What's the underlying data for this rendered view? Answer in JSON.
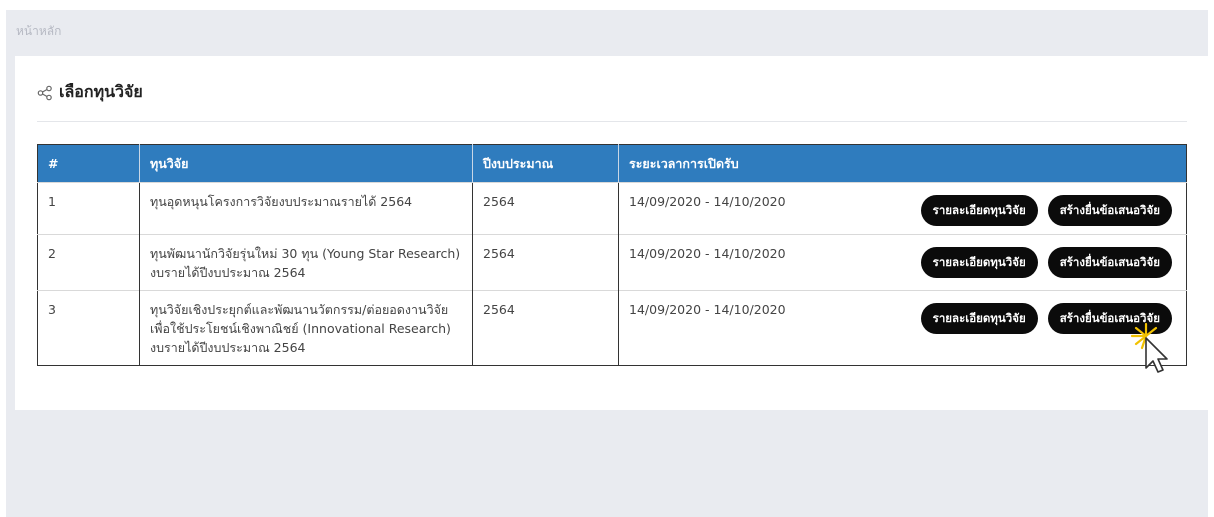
{
  "breadcrumb": "หน้าหลัก",
  "card": {
    "title": "เลือกทุนวิจัย",
    "title_icon": "share-icon"
  },
  "table": {
    "headers": [
      "#",
      "ทุนวิจัย",
      "ปีงบประมาณ",
      "ระยะเวลาการเปิดรับ"
    ],
    "rows": [
      {
        "num": "1",
        "fund": "ทุนอุดหนุนโครงการวิจัยงบประมาณรายได้ 2564",
        "year": "2564",
        "period": "14/09/2020 - 14/10/2020",
        "detail_label": "รายละเอียดทุนวิจัย",
        "create_label": "สร้างยื่นข้อเสนอวิจัย"
      },
      {
        "num": "2",
        "fund": "ทุนพัฒนานักวิจัยรุ่นใหม่ 30 ทุน (Young Star Research) งบรายได้ปีงบประมาณ 2564",
        "year": "2564",
        "period": "14/09/2020 - 14/10/2020",
        "detail_label": "รายละเอียดทุนวิจัย",
        "create_label": "สร้างยื่นข้อเสนอวิจัย"
      },
      {
        "num": "3",
        "fund": "ทุนวิจัยเชิงประยุกต์และพัฒนานวัตกรรม/ต่อยอดงานวิจัยเพื่อใช้ประโยชน์เชิงพาณิชย์ (Innovational Research) งบรายได้ปีงบประมาณ 2564",
        "year": "2564",
        "period": "14/09/2020 - 14/10/2020",
        "detail_label": "รายละเอียดทุนวิจัย",
        "create_label": "สร้างยื่นข้อเสนอวิจัย"
      }
    ]
  },
  "colors": {
    "header_bg": "#2f7cbe",
    "button_bg": "#0b0b0b",
    "page_bg": "#e9ebf0"
  }
}
